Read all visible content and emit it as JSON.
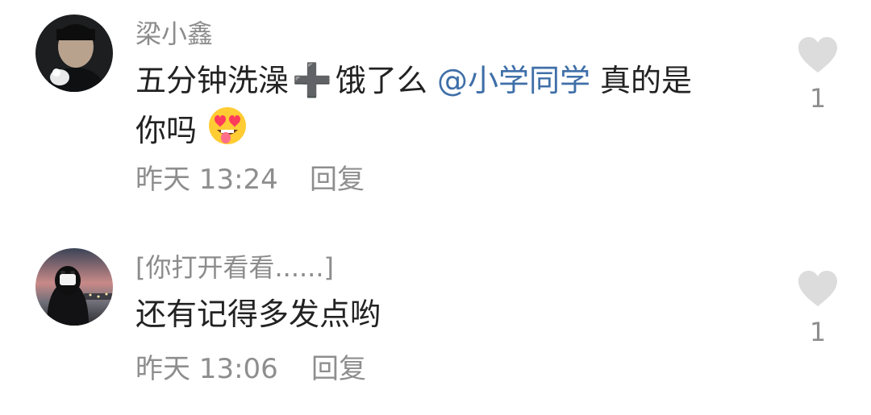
{
  "comments": [
    {
      "username": "梁小鑫",
      "text_part1": "五分钟洗澡",
      "plus_glyph": "➕",
      "text_part2": "饿了么",
      "mention": "@小学同学",
      "text_part3": "真的是",
      "text_part4": "你吗",
      "emoji": "heart-eyes-tongue-emoji",
      "time": "昨天 13:24",
      "reply_label": "回复",
      "like_count": "1"
    },
    {
      "username": "[你打开看看......]",
      "text": "还有记得多发点哟",
      "time": "昨天 13:06",
      "reply_label": "回复",
      "like_count": "1"
    }
  ],
  "colors": {
    "username": "#8c8c8c",
    "text": "#222222",
    "mention": "#3f6fa8",
    "meta": "#8e8e8e",
    "heart": "#dcdcdc"
  }
}
